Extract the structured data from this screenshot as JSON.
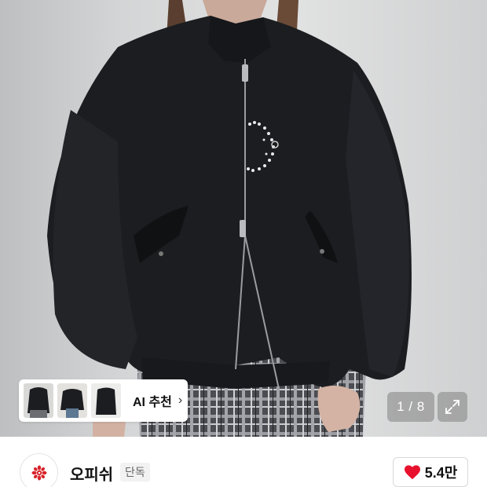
{
  "product_image": {
    "image_counter": "1 / 8",
    "expand_icon": "expand-icon"
  },
  "ai_recommend": {
    "label": "AI 추천",
    "chevron": "›",
    "thumbnails": [
      "thumbnail-1",
      "thumbnail-2",
      "thumbnail-3"
    ]
  },
  "brand": {
    "name": "오피쉬",
    "badge": "단독",
    "logo_icon": "brand-logo-icon"
  },
  "like": {
    "icon": "heart-icon",
    "count": "5.4만"
  },
  "colors": {
    "heart": "#e8112d",
    "brand_logo": "#d8232a",
    "jacket": "#1a1c1f"
  }
}
